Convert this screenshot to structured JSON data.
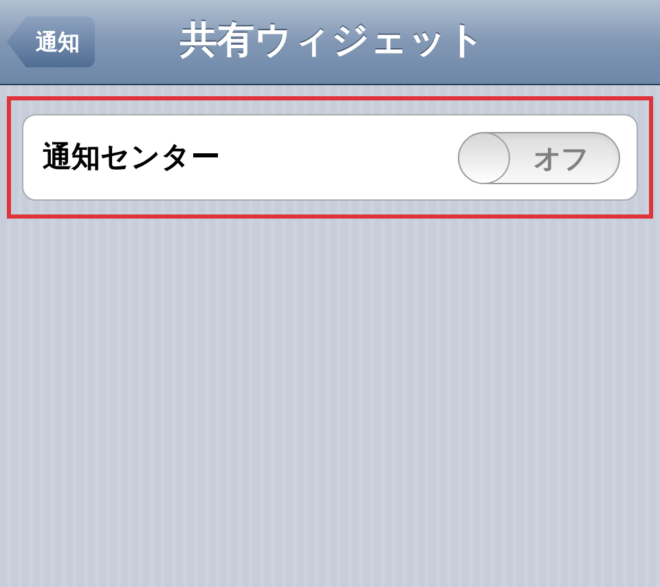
{
  "nav_bar": {
    "back_button": "通知",
    "title": "共有ウィジェット"
  },
  "settings": [
    {
      "label": "通知センター",
      "highlighted": true,
      "switch": {
        "on": false,
        "label": "オフ"
      }
    }
  ]
}
